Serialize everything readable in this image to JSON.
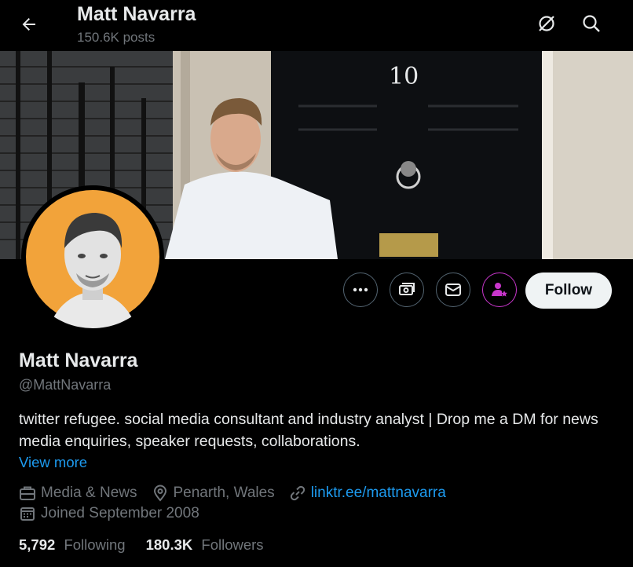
{
  "header": {
    "title": "Matt Navarra",
    "posts_count": "150.6K posts",
    "back_icon": "arrow-left-icon",
    "icons": [
      "grok-icon",
      "search-icon"
    ]
  },
  "banner": {
    "door_number": "10"
  },
  "actions": {
    "more_icon": "more-icon",
    "subscribe_icon": "money-icon",
    "message_icon": "mail-icon",
    "notify_icon": "person-star-icon",
    "follow_label": "Follow"
  },
  "profile": {
    "name": "Matt Navarra",
    "handle": "@MattNavarra",
    "bio": "twitter refugee. social media consultant and industry analyst | Drop me a DM for news media enquiries, speaker requests, collaborations.",
    "view_more": "View more",
    "category": "Media & News",
    "location": "Penarth, Wales",
    "website": "linktr.ee/mattnavarra",
    "joined": "Joined September 2008"
  },
  "stats": {
    "following_count": "5,792",
    "following_label": "Following",
    "followers_count": "180.3K",
    "followers_label": "Followers"
  },
  "colors": {
    "accent": "#1d9bf0",
    "muted": "#71767b",
    "verified_purple": "#c936cc",
    "avatar_bg": "#f2a33a"
  }
}
